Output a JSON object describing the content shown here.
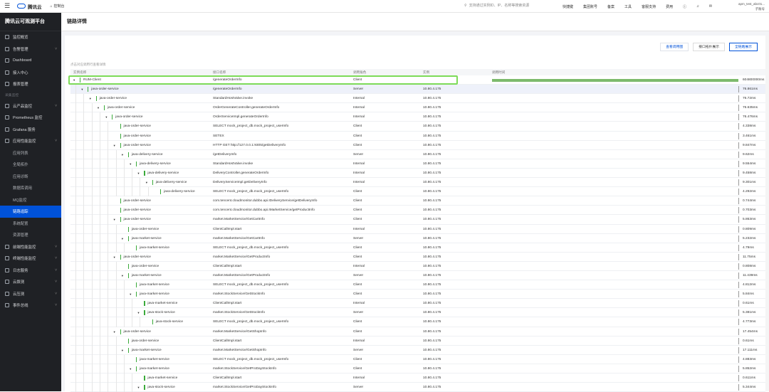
{
  "topbar": {
    "brand": "腾讯云",
    "console": "控制台",
    "search_placeholder": "支持通过实例ID、IP、名称等搜索资源",
    "nav": [
      "快捷键",
      "集团账号",
      "备案",
      "工具",
      "客服支持",
      "费用"
    ],
    "account": "apm_test_abc01...",
    "account_sub": "子账号"
  },
  "sidebar": {
    "brand": "腾讯云可观测平台",
    "group_label": "采集监控",
    "items": [
      {
        "label": "监控概览",
        "type": "top"
      },
      {
        "label": "告警管理",
        "type": "top",
        "chev": true
      },
      {
        "label": "Dashboard",
        "type": "top"
      },
      {
        "label": "接入中心",
        "type": "top"
      },
      {
        "label": "报表管理",
        "type": "top"
      },
      {
        "label": "__group__",
        "type": "group"
      },
      {
        "label": "云产品监控",
        "type": "top",
        "chev": true
      },
      {
        "label": "Prometheus 监控",
        "type": "top"
      },
      {
        "label": "Grafana 服务",
        "type": "top"
      },
      {
        "label": "应用性能监控",
        "type": "top",
        "chev": true
      },
      {
        "label": "应用列表",
        "type": "sub"
      },
      {
        "label": "全局拓扑",
        "type": "sub"
      },
      {
        "label": "应用诊断",
        "type": "sub"
      },
      {
        "label": "数据库调用",
        "type": "sub"
      },
      {
        "label": "MQ监控",
        "type": "sub"
      },
      {
        "label": "链路追踪",
        "type": "sub",
        "active": true
      },
      {
        "label": "系统配置",
        "type": "sub"
      },
      {
        "label": "资源管理",
        "type": "sub"
      },
      {
        "label": "前端性能监控",
        "type": "top",
        "chev": true
      },
      {
        "label": "终端性能监控",
        "type": "top",
        "chev": true
      },
      {
        "label": "日志服务",
        "type": "top",
        "chev": true
      },
      {
        "label": "云拨测",
        "type": "top",
        "chev": true
      },
      {
        "label": "云压测",
        "type": "top",
        "chev": true
      },
      {
        "label": "事件总线",
        "type": "top",
        "chev": true
      }
    ]
  },
  "page": {
    "title": "链路详情",
    "buttons": [
      "查看调用图",
      "接口拓扑展示",
      "全链路展示"
    ],
    "hint": "点击对应调用行查看详情",
    "columns": [
      "实例名称",
      "接口名称",
      "调用角色",
      "实例",
      "调用时间"
    ]
  },
  "spans": [
    {
      "depth": 0,
      "service": "RUM-Client",
      "endpoint": "/generateOrderInfo",
      "role": "Client",
      "instance": "",
      "duration": "604800000ms",
      "bar": [
        0.0,
        1.0
      ],
      "expanded": true
    },
    {
      "depth": 1,
      "service": "java-order-service",
      "endpoint": "/generateOrderInfo",
      "role": "Server",
      "instance": "10.80.4.175",
      "duration": "76.861ms",
      "bar": [
        0.999,
        0.0001
      ],
      "expanded": true,
      "selected": true
    },
    {
      "depth": 2,
      "service": "java-order-service",
      "endpoint": "StandardHostValve.invoke",
      "role": "Internal",
      "instance": "10.80.4.175",
      "duration": "76.72ms",
      "bar": [
        0.999,
        0.0001
      ],
      "expanded": true
    },
    {
      "depth": 3,
      "service": "java-order-service",
      "endpoint": "OrderGenerateController.generateOrderInfo",
      "role": "Internal",
      "instance": "10.80.4.175",
      "duration": "76.635ms",
      "bar": [
        0.999,
        0.0001
      ],
      "expanded": true
    },
    {
      "depth": 4,
      "service": "java-order-service",
      "endpoint": "OrderServiceImpl.generateOrderInfo",
      "role": "Internal",
      "instance": "10.80.4.175",
      "duration": "76.476ms",
      "bar": [
        0.999,
        0.0001
      ],
      "expanded": true
    },
    {
      "depth": 5,
      "service": "java-order-service",
      "endpoint": "SELECT mock_project_db.mock_project_userInfo",
      "role": "Client",
      "instance": "10.80.4.175",
      "duration": "4.338ms",
      "bar": [
        0.999,
        0.0001
      ],
      "leaf": true
    },
    {
      "depth": 5,
      "service": "java-order-service",
      "endpoint": "SETEX",
      "role": "Client",
      "instance": "10.80.4.175",
      "duration": "3.461ms",
      "bar": [
        0.999,
        0.0001
      ],
      "leaf": true
    },
    {
      "depth": 5,
      "service": "java-order-service",
      "endpoint": "HTTP GET http://127.0.0.1:9305/getDeliveryInfo",
      "role": "Client",
      "instance": "10.80.4.175",
      "duration": "9.847ms",
      "bar": [
        0.999,
        0.0001
      ],
      "expanded": true
    },
    {
      "depth": 6,
      "service": "java-delivery-service",
      "endpoint": "/getDeliveryInfo",
      "role": "Server",
      "instance": "10.80.4.175",
      "duration": "9.62ms",
      "bar": [
        0.999,
        0.0001
      ],
      "expanded": true
    },
    {
      "depth": 7,
      "service": "java-delivery-service",
      "endpoint": "StandardHostValve.invoke",
      "role": "Internal",
      "instance": "10.80.4.175",
      "duration": "9.554ms",
      "bar": [
        0.999,
        0.0001
      ],
      "expanded": true
    },
    {
      "depth": 8,
      "service": "java-delivery-service",
      "endpoint": "DeliveryController.generateOrderInfo",
      "role": "Internal",
      "instance": "10.80.4.175",
      "duration": "9.458ms",
      "bar": [
        0.999,
        0.0001
      ],
      "expanded": true
    },
    {
      "depth": 9,
      "service": "java-delivery-service",
      "endpoint": "DeliveryServiceImpl.getDeliveryInfo",
      "role": "Internal",
      "instance": "10.80.4.175",
      "duration": "9.301ms",
      "bar": [
        0.999,
        0.0001
      ],
      "expanded": true
    },
    {
      "depth": 10,
      "service": "java-delivery-service",
      "endpoint": "SELECT mock_project_db.mock_project_userInfo",
      "role": "Client",
      "instance": "10.80.4.175",
      "duration": "4.292ms",
      "bar": [
        0.999,
        0.0001
      ],
      "leaf": true
    },
    {
      "depth": 5,
      "service": "java-order-service",
      "endpoint": "com.tencent.cloudmonitor.dubbo.api.IDeliveryService/getDeliveryInfo",
      "role": "Client",
      "instance": "10.80.4.175",
      "duration": "0.744ms",
      "bar": [
        0.999,
        0.0001
      ],
      "leaf": true
    },
    {
      "depth": 5,
      "service": "java-order-service",
      "endpoint": "com.tencent.cloudmonitor.dubbo.api.IMarketService/getProductInfo",
      "role": "Client",
      "instance": "10.80.4.175",
      "duration": "0.703ms",
      "bar": [
        0.999,
        0.0001
      ],
      "leaf": true
    },
    {
      "depth": 5,
      "service": "java-order-service",
      "endpoint": "market.MarketService/GetCartInfo",
      "role": "Client",
      "instance": "10.80.4.175",
      "duration": "5.863ms",
      "bar": [
        0.999,
        0.0001
      ],
      "expanded": true
    },
    {
      "depth": 6,
      "service": "java-order-service",
      "endpoint": "ClientCallImpl.start",
      "role": "Internal",
      "instance": "10.80.4.175",
      "duration": "0.809ms",
      "bar": [
        0.999,
        0.0001
      ],
      "leaf": true
    },
    {
      "depth": 6,
      "service": "java-market-service",
      "endpoint": "market.MarketService/GetCartInfo",
      "role": "Server",
      "instance": "10.80.4.175",
      "duration": "5.232ms",
      "bar": [
        0.999,
        0.0001
      ],
      "expanded": true
    },
    {
      "depth": 7,
      "service": "java-market-service",
      "endpoint": "SELECT mock_project_db.mock_project_userInfo",
      "role": "Client",
      "instance": "10.80.4.175",
      "duration": "4.79ms",
      "bar": [
        0.999,
        0.0001
      ],
      "leaf": true
    },
    {
      "depth": 5,
      "service": "java-order-service",
      "endpoint": "market.MarketService/GetProductInfo",
      "role": "Client",
      "instance": "10.80.4.175",
      "duration": "11.75ms",
      "bar": [
        0.999,
        0.0001
      ],
      "expanded": true
    },
    {
      "depth": 6,
      "service": "java-order-service",
      "endpoint": "ClientCallImpl.start",
      "role": "Internal",
      "instance": "10.80.4.175",
      "duration": "0.808ms",
      "bar": [
        0.999,
        0.0001
      ],
      "leaf": true
    },
    {
      "depth": 6,
      "service": "java-market-service",
      "endpoint": "market.MarketService/GetProductInfo",
      "role": "Server",
      "instance": "10.80.4.175",
      "duration": "11.439ms",
      "bar": [
        0.999,
        0.0001
      ],
      "expanded": true
    },
    {
      "depth": 7,
      "service": "java-market-service",
      "endpoint": "SELECT mock_project_db.mock_project_userInfo",
      "role": "Client",
      "instance": "10.80.4.175",
      "duration": "4.812ms",
      "bar": [
        0.999,
        0.0001
      ],
      "leaf": true
    },
    {
      "depth": 7,
      "service": "java-market-service",
      "endpoint": "market.StockService/GetStockInfo",
      "role": "Client",
      "instance": "10.80.4.175",
      "duration": "5.84ms",
      "bar": [
        0.999,
        0.0001
      ],
      "expanded": true
    },
    {
      "depth": 8,
      "service": "java-market-service",
      "endpoint": "ClientCallImpl.start",
      "role": "Internal",
      "instance": "10.80.4.175",
      "duration": "0.61ms",
      "bar": [
        0.999,
        0.0001
      ],
      "leaf": true
    },
    {
      "depth": 8,
      "service": "java-stock-service",
      "endpoint": "market.StockService/GetStockInfo",
      "role": "Server",
      "instance": "10.80.4.175",
      "duration": "5.381ms",
      "bar": [
        0.999,
        0.0001
      ],
      "expanded": true
    },
    {
      "depth": 9,
      "service": "java-stock-service",
      "endpoint": "SELECT mock_project_db.mock_project_userInfo",
      "role": "Client",
      "instance": "10.80.4.175",
      "duration": "4.773ms",
      "bar": [
        0.999,
        0.0001
      ],
      "leaf": true
    },
    {
      "depth": 5,
      "service": "java-order-service",
      "endpoint": "market.MarketService/GetShopInfo",
      "role": "Client",
      "instance": "10.80.4.175",
      "duration": "17.454ms",
      "bar": [
        0.999,
        0.0001
      ],
      "expanded": true
    },
    {
      "depth": 6,
      "service": "java-order-service",
      "endpoint": "ClientCallImpl.start",
      "role": "Internal",
      "instance": "10.80.4.175",
      "duration": "0.61ms",
      "bar": [
        0.999,
        0.0001
      ],
      "leaf": true
    },
    {
      "depth": 6,
      "service": "java-market-service",
      "endpoint": "market.MarketService/GetShopInfo",
      "role": "Server",
      "instance": "10.80.4.175",
      "duration": "17.111ms",
      "bar": [
        0.999,
        0.0001
      ],
      "expanded": true
    },
    {
      "depth": 7,
      "service": "java-market-service",
      "endpoint": "SELECT mock_project_db.mock_project_userInfo",
      "role": "Client",
      "instance": "10.80.4.175",
      "duration": "4.883ms",
      "bar": [
        0.999,
        0.0001
      ],
      "leaf": true
    },
    {
      "depth": 7,
      "service": "java-market-service",
      "endpoint": "market.StockService/GetProDayStockInfo",
      "role": "Client",
      "instance": "10.80.4.175",
      "duration": "5.852ms",
      "bar": [
        0.999,
        0.0001
      ],
      "expanded": true
    },
    {
      "depth": 8,
      "service": "java-market-service",
      "endpoint": "ClientCallImpl.start",
      "role": "Internal",
      "instance": "10.80.4.175",
      "duration": "0.611ms",
      "bar": [
        0.999,
        0.0001
      ],
      "leaf": true
    },
    {
      "depth": 8,
      "service": "java-stock-service",
      "endpoint": "market.StockService/GetProDayStockInfo",
      "role": "Server",
      "instance": "10.80.4.175",
      "duration": "5.344ms",
      "bar": [
        0.999,
        0.0001
      ],
      "expanded": true
    }
  ],
  "colors": {
    "accent": "#0052d9",
    "bar": "#7dba6c",
    "highlight": "#7ddb58",
    "sidebar_bg": "#1f2125"
  }
}
